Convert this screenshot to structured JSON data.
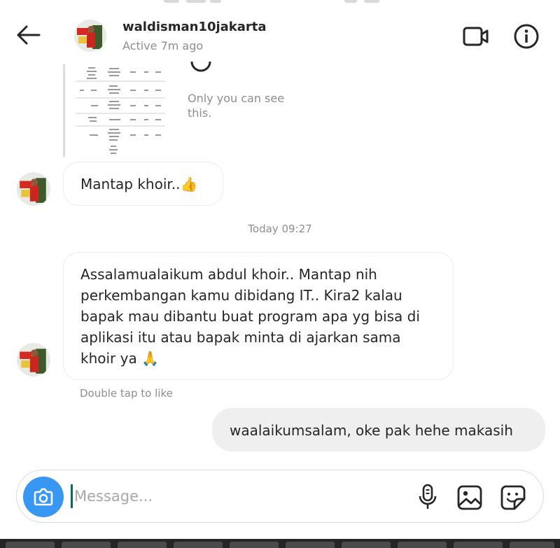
{
  "header": {
    "username": "waldisman10jakarta",
    "status": "Active 7m ago"
  },
  "shared_post": {
    "visibility_note": "Only you can see this."
  },
  "messages": [
    {
      "direction": "incoming",
      "text": "Mantap khoir..👍"
    },
    {
      "direction": "incoming",
      "text": "Assalamualaikum abdul khoir.. Mantap nih perkembangan kamu dibidang IT.. Kira2 kalau bapak mau dibantu buat program apa yg bisa di aplikasi itu atau bapak minta di ajarkan sama khoir ya 🙏"
    },
    {
      "direction": "outgoing",
      "text": "waalaikumsalam, oke pak hehe makasih"
    }
  ],
  "timestamp": "Today 09:27",
  "like_hint": "Double tap to like",
  "composer": {
    "placeholder": "Message..."
  },
  "icons": {
    "back": "arrow-left-icon",
    "video": "video-camera-icon",
    "info": "info-icon",
    "camera": "camera-icon",
    "mic": "microphone-icon",
    "gallery": "image-icon",
    "sticker": "sticker-icon"
  },
  "colors": {
    "camera_button": "#3897f0",
    "outgoing_bubble": "#efefef",
    "secondary_text": "#8e8e8e"
  }
}
